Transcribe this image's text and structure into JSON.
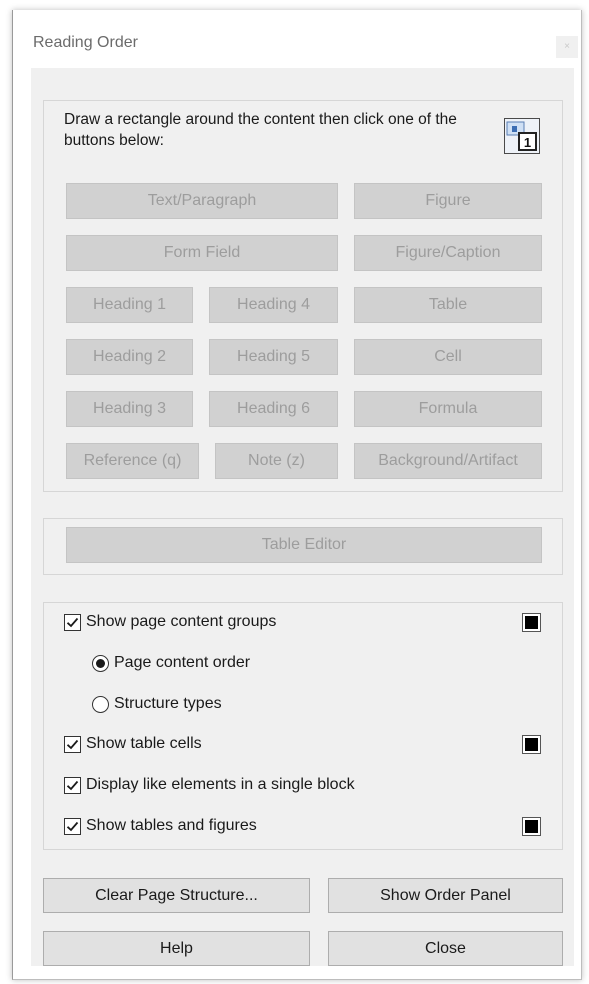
{
  "window": {
    "title": "Reading Order",
    "close_glyph": "×"
  },
  "instructions": "Draw a rectangle around the content then click one of the buttons below:",
  "tag_buttons": {
    "text_paragraph": "Text/Paragraph",
    "figure": "Figure",
    "form_field": "Form Field",
    "figure_caption": "Figure/Caption",
    "heading1": "Heading 1",
    "heading4": "Heading 4",
    "table": "Table",
    "heading2": "Heading 2",
    "heading5": "Heading 5",
    "cell": "Cell",
    "heading3": "Heading 3",
    "heading6": "Heading 6",
    "formula": "Formula",
    "reference": "Reference (q)",
    "note": "Note (z)",
    "background": "Background/Artifact"
  },
  "table_editor": "Table Editor",
  "options": {
    "show_groups": {
      "label": "Show page content groups",
      "checked": true
    },
    "page_order": {
      "label": "Page content order",
      "selected": true
    },
    "structure_types": {
      "label": "Structure types",
      "selected": false
    },
    "show_cells": {
      "label": "Show table cells",
      "checked": true
    },
    "like_elements": {
      "label": "Display like elements in a single block",
      "checked": true
    },
    "tables_figures": {
      "label": "Show tables and figures",
      "checked": true
    }
  },
  "swatch_color": "#000000",
  "actions": {
    "clear": "Clear Page Structure...",
    "order_panel": "Show Order Panel",
    "help": "Help",
    "close": "Close"
  }
}
